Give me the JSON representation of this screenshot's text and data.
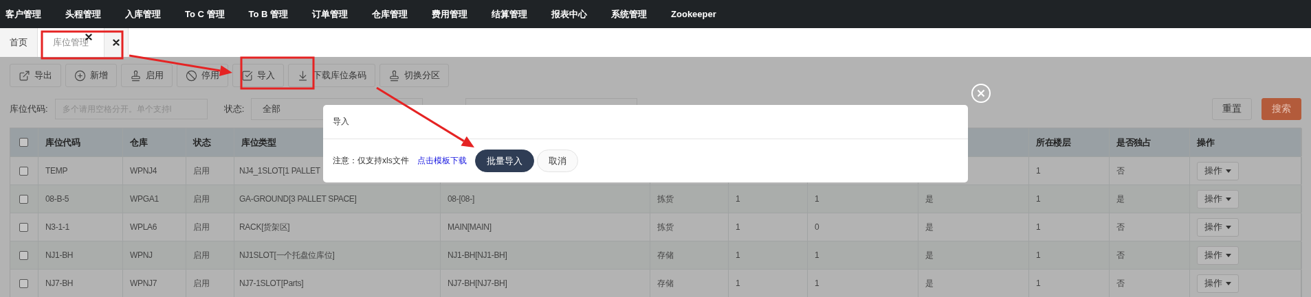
{
  "nav": [
    "客户管理",
    "头程管理",
    "入库管理",
    "To C 管理",
    "To B 管理",
    "订单管理",
    "仓库管理",
    "费用管理",
    "结算管理",
    "报表中心",
    "系统管理",
    "Zookeeper"
  ],
  "tabs": [
    {
      "label": "首页",
      "selected": false,
      "closable": false
    },
    {
      "label": "库位管理",
      "selected": true,
      "closable": true
    }
  ],
  "toolbar": [
    "导出",
    "新增",
    "启用",
    "停用",
    "导入",
    "下载库位条码",
    "切换分区"
  ],
  "filters": {
    "code": {
      "label": "库位代码:",
      "placeholder": "多个请用空格分开。单个支持l"
    },
    "status": {
      "label": "状态:",
      "value": "全部"
    },
    "reset": "重置",
    "search": "搜索"
  },
  "table": {
    "header_checked": false,
    "columns": [
      "库位代码",
      "仓库",
      "状态",
      "库位类型",
      null,
      null,
      null,
      null,
      null,
      "所在楼层",
      "是否独占",
      "操作"
    ],
    "rows": [
      {
        "checked": false,
        "cells": [
          "TEMP",
          "WPNJ4",
          "启用",
          "NJ4_1SLOT[1 PALLET",
          null,
          null,
          null,
          null,
          null,
          "1",
          "否"
        ],
        "action": "操作"
      },
      {
        "checked": false,
        "cells": [
          "08-B-5",
          "WPGA1",
          "启用",
          "GA-GROUND[3 PALLET SPACE]",
          "08-[08-]",
          "拣货",
          "1",
          "1",
          "是",
          "1",
          "是"
        ],
        "action": "操作"
      },
      {
        "checked": false,
        "cells": [
          "N3-1-1",
          "WPLA6",
          "启用",
          "RACK[货架区]",
          "MAIN[MAIN]",
          "拣货",
          "1",
          "0",
          "是",
          "1",
          "否"
        ],
        "action": "操作"
      },
      {
        "checked": false,
        "cells": [
          "NJ1-BH",
          "WPNJ",
          "启用",
          "NJ1SLOT[一个托盘位库位]",
          "NJ1-BH[NJ1-BH]",
          "存储",
          "1",
          "1",
          "是",
          "1",
          "否"
        ],
        "action": "操作"
      },
      {
        "checked": false,
        "cells": [
          "NJ7-BH",
          "WPNJ7",
          "启用",
          "NJ7-1SLOT[Parts]",
          "NJ7-BH[NJ7-BH]",
          "存储",
          "1",
          "1",
          "是",
          "1",
          "否"
        ],
        "action": "操作"
      }
    ]
  },
  "modal": {
    "title": "导入",
    "note": "注意：仅支持xls文件",
    "link": "点击模板下载",
    "primary": "批量导入",
    "cancel": "取消"
  }
}
